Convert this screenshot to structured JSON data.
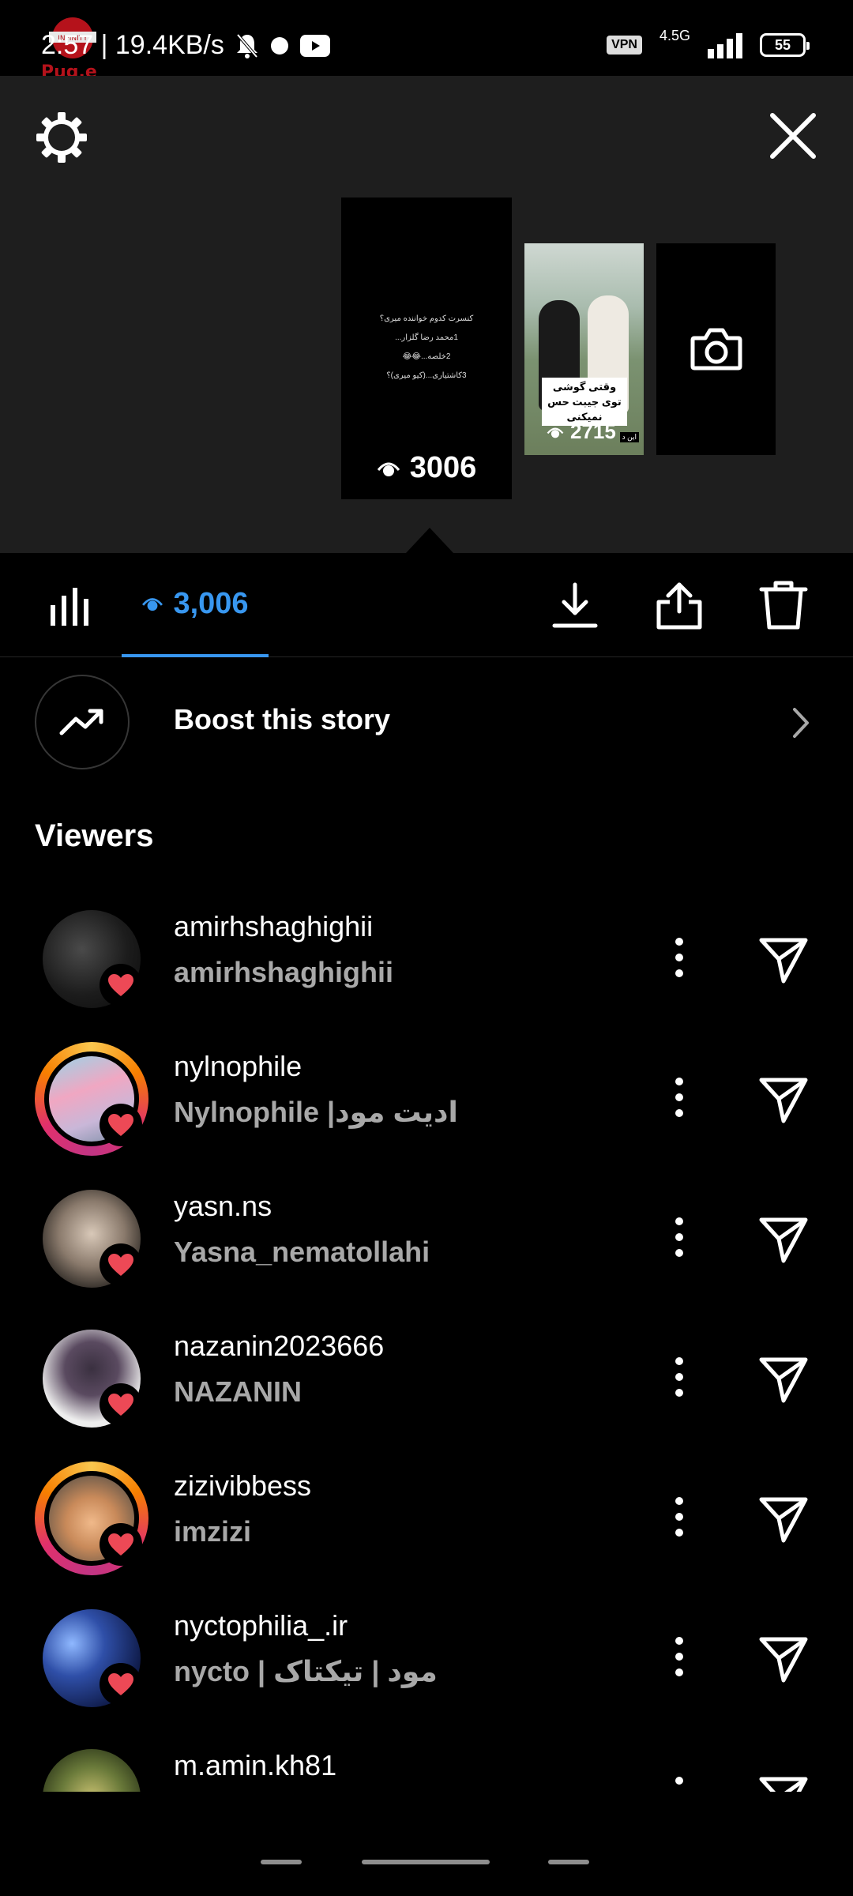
{
  "status_bar": {
    "time_speed": "2:57 | 19.4KB/s",
    "vpn": "VPN",
    "network": "4.5G",
    "battery": "55"
  },
  "top": {
    "story_text_lines": [
      "کنسرت کدوم خواننده میری؟",
      "1محمد رضا گلزار...",
      "2خلصه...😂😂",
      "3کاشتیاری...(کیو میری)؟"
    ],
    "current_views": "3006",
    "second_caption": "وقتی گوشی توی جیبت حس نمیکنی",
    "second_views": "2715",
    "second_tag": "این د"
  },
  "tabs": {
    "views_count": "3,006"
  },
  "boost": {
    "label": "Boost this story"
  },
  "viewers": {
    "title": "Viewers",
    "items": [
      {
        "username": "amirhshaghighii",
        "name": "amirhshaghighii"
      },
      {
        "username": "nylnophile",
        "name": "Nylnophile |ادیت مود"
      },
      {
        "username": "yasn.ns",
        "name": "Yasna_nematollahi"
      },
      {
        "username": "nazanin2023666",
        "name": "NAZANIN"
      },
      {
        "username": "zizivibbess",
        "name": "imzizi"
      },
      {
        "username": "nyctophilia_.ir",
        "name": "nycto | مود | تیکتاک"
      },
      {
        "username": "m.amin.kh81",
        "name": ""
      }
    ]
  },
  "colors": {
    "accent": "#3897f0",
    "heart": "#ed4956",
    "background": "#000000",
    "top_bg": "#1e1e1e"
  }
}
